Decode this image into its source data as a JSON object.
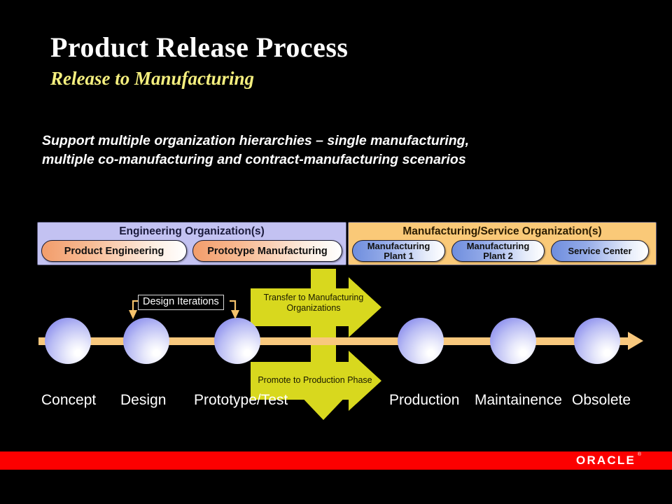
{
  "slide": {
    "title": "Product Release Process",
    "subtitle": "Release to Manufacturing",
    "background_color": "#000000"
  },
  "body": {
    "line1": "Support multiple organization hierarchies – single manufacturing,",
    "line2": "multiple co-manufacturing and contract-manufacturing scenarios"
  },
  "organizations": {
    "engineering": {
      "title": "Engineering Organization(s)",
      "panel_color": "#c3c2f2",
      "units": [
        {
          "label": "Product Engineering"
        },
        {
          "label": "Prototype Manufacturing"
        }
      ]
    },
    "manufacturing": {
      "title": "Manufacturing/Service Organization(s)",
      "panel_color": "#fac978",
      "units": [
        {
          "label": "Manufacturing\nPlant 1"
        },
        {
          "label": "Manufacturing\nPlant 2"
        },
        {
          "label": "Service Center"
        }
      ]
    }
  },
  "process_flow": {
    "timeline_color": "#f8c87d",
    "sphere_color": "#8f92ee",
    "phases": [
      {
        "label": "Concept"
      },
      {
        "label": "Design"
      },
      {
        "label": "Prototype/Test"
      },
      {
        "label": "Production"
      },
      {
        "label": "Maintainence"
      },
      {
        "label": "Obsolete"
      }
    ],
    "callout": {
      "label": "Design Iterations",
      "connector_color": "#f5c26b"
    },
    "transfer_arrows": {
      "color": "#d8d81e",
      "upper": {
        "line1": "Transfer to Manufacturing",
        "line2": "Organizations"
      },
      "lower": {
        "line1": "Promote to Production Phase"
      }
    }
  },
  "footer": {
    "band_color": "#fc0000",
    "logo_text": "ORACLE",
    "registered_mark": "®"
  }
}
